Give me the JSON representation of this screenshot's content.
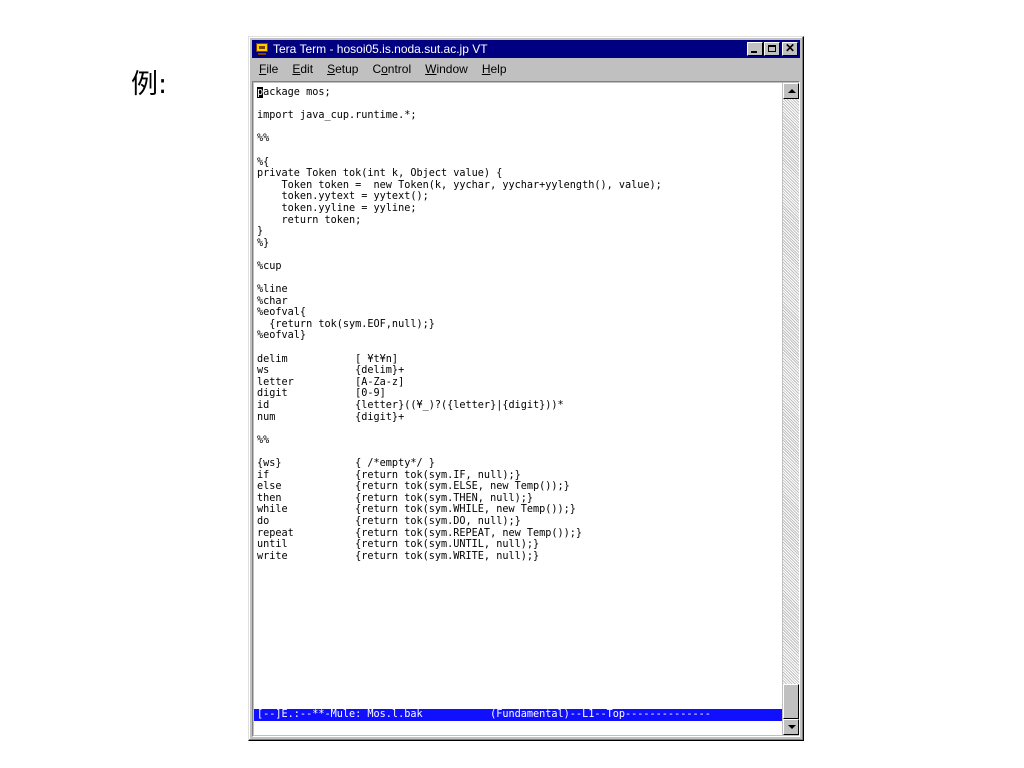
{
  "slide": {
    "label": "例:"
  },
  "window": {
    "title": "Tera Term - hosoi05.is.noda.sut.ac.jp VT",
    "menu": [
      {
        "label": "File"
      },
      {
        "label": "Edit"
      },
      {
        "label": "Setup"
      },
      {
        "label": "Control"
      },
      {
        "label": "Window"
      },
      {
        "label": "Help"
      }
    ]
  },
  "terminal": {
    "cursor_char": "p",
    "text": "ackage mos;\n\nimport java_cup.runtime.*;\n\n%%\n\n%{\nprivate Token tok(int k, Object value) {\n    Token token =  new Token(k, yychar, yychar+yylength(), value);\n    token.yytext = yytext();\n    token.yyline = yyline;\n    return token;\n}\n%}\n\n%cup\n\n%line\n%char\n%eofval{\n  {return tok(sym.EOF,null);}\n%eofval}\n\ndelim           [ ¥t¥n]\nws              {delim}+\nletter          [A-Za-z]\ndigit           [0-9]\nid              {letter}((¥_)?({letter}|{digit}))*\nnum             {digit}+\n\n%%\n\n{ws}            { /*empty*/ }\nif              {return tok(sym.IF, null);}\nelse            {return tok(sym.ELSE, new Temp());}\nthen            {return tok(sym.THEN, null);}\nwhile           {return tok(sym.WHILE, new Temp());}\ndo              {return tok(sym.DO, null);}\nrepeat          {return tok(sym.REPEAT, new Temp());}\nuntil           {return tok(sym.UNTIL, null);}\nwrite           {return tok(sym.WRITE, null);}",
    "modeline": "[--]E.:--**-Mule: Mos.l.bak           (Fundamental)--L1--Top--------------"
  },
  "colors": {
    "titlebar": "#000080",
    "modeline_bg": "#1010ff",
    "window_face": "#c0c0c0",
    "terminal_bg": "#ffffff"
  }
}
